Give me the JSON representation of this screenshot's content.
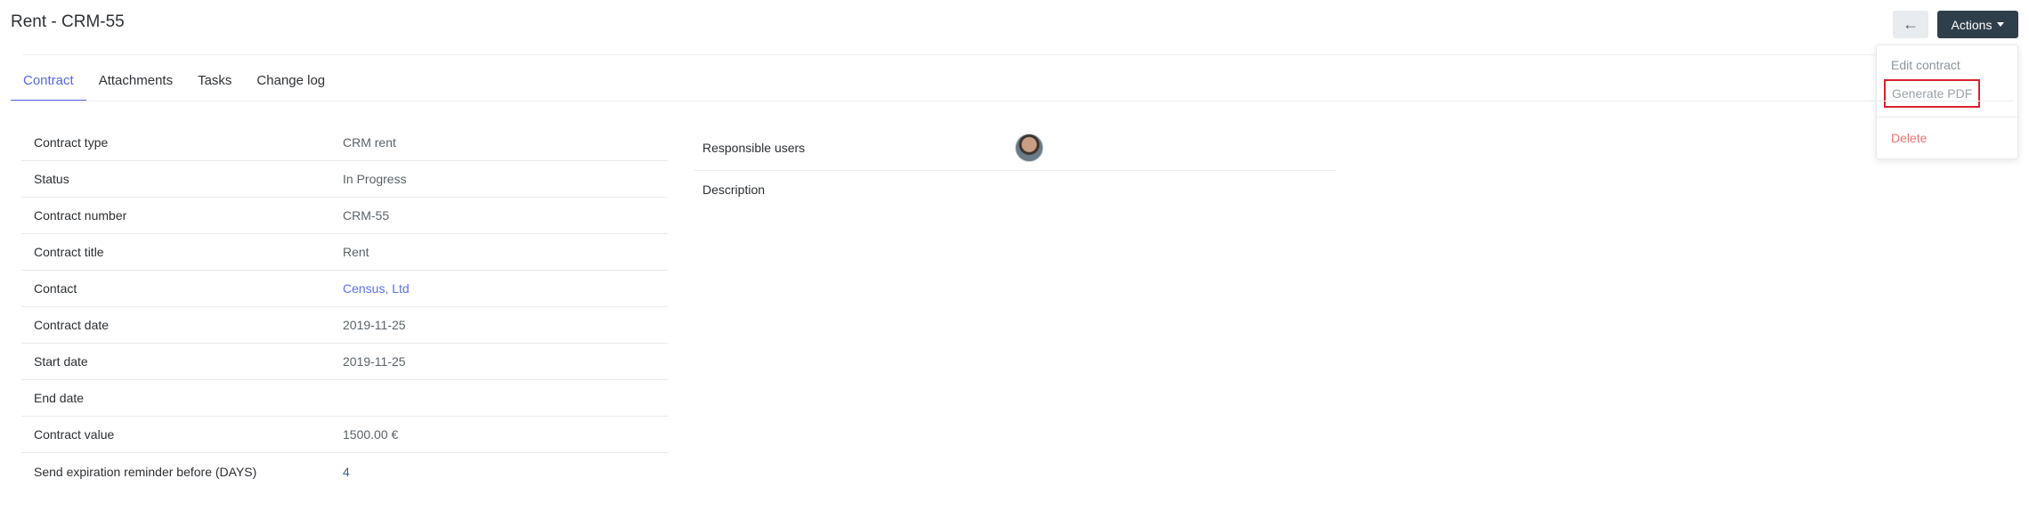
{
  "header": {
    "title": "Rent - CRM-55",
    "back_icon": "arrow-left-icon",
    "actions_label": "Actions"
  },
  "dropdown": {
    "edit": "Edit contract",
    "generate_pdf": "Generate PDF",
    "delete": "Delete",
    "colors": {
      "delete": "#f07470",
      "highlight_border": "#d9232d"
    }
  },
  "tabs": [
    {
      "label": "Contract",
      "active": true
    },
    {
      "label": "Attachments",
      "active": false
    },
    {
      "label": "Tasks",
      "active": false
    },
    {
      "label": "Change log",
      "active": false
    }
  ],
  "details": [
    {
      "label": "Contract type",
      "value": "CRM rent"
    },
    {
      "label": "Status",
      "value": "In Progress"
    },
    {
      "label": "Contract number",
      "value": "CRM-55"
    },
    {
      "label": "Contract title",
      "value": "Rent"
    },
    {
      "label": "Contact",
      "value": "Census, Ltd"
    },
    {
      "label": "Contract date",
      "value": "2019-11-25"
    },
    {
      "label": "Start date",
      "value": "2019-11-25"
    },
    {
      "label": "End date",
      "value": ""
    },
    {
      "label": "Contract value",
      "value": "1500.00 €"
    },
    {
      "label": "Send expiration reminder before (DAYS)",
      "value": "4"
    }
  ],
  "right": {
    "responsible_users_label": "Responsible users",
    "description_label": "Description"
  },
  "colors": {
    "accent": "#5468e6",
    "actions_bg": "#2f3e4b",
    "back_bg": "#e8ebef"
  }
}
